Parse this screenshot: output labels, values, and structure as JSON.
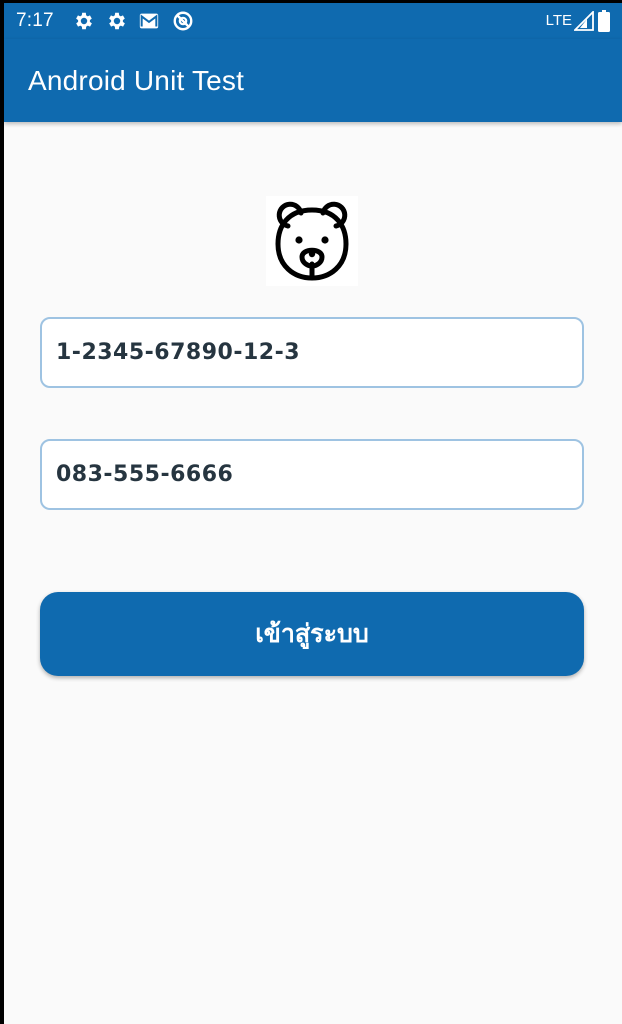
{
  "status_bar": {
    "time": "7:17",
    "network": "LTE",
    "left_icons": [
      "gear-icon",
      "gear-icon",
      "gmail-icon",
      "no-disturb-icon"
    ],
    "right_icons": [
      "signal-icon",
      "battery-icon"
    ]
  },
  "app_bar": {
    "title": "Android Unit Test",
    "color": "#0f6aaf"
  },
  "logo": {
    "icon": "bear-icon"
  },
  "form": {
    "id_field_value": "1-2345-67890-12-3",
    "phone_field_value": "083-555-6666",
    "login_label": "เข้าสู่ระบบ",
    "accent_color": "#0f6aaf"
  }
}
